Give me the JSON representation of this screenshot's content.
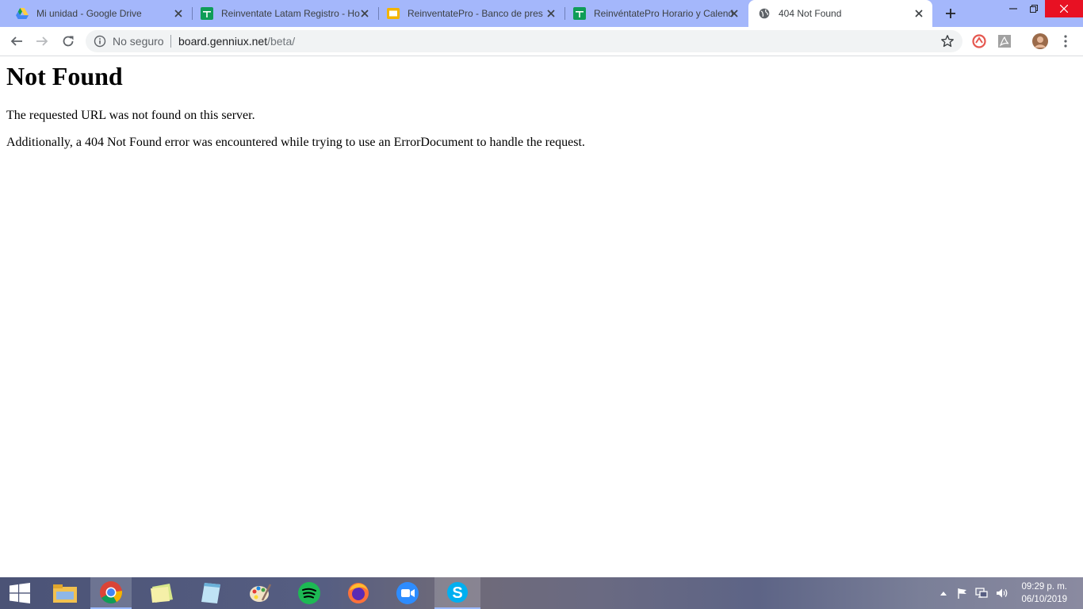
{
  "browser": {
    "tabs": [
      {
        "title": "Mi unidad - Google Drive",
        "icon": "google-drive-icon"
      },
      {
        "title": "Reinventate Latam Registro - Ho",
        "icon": "google-sheets-icon"
      },
      {
        "title": "ReinventatePro - Banco de pres",
        "icon": "google-slides-icon"
      },
      {
        "title": "ReinvéntatePro Horario y Calend",
        "icon": "google-sheets-icon"
      },
      {
        "title": "404 Not Found",
        "icon": "globe-icon",
        "active": true
      }
    ],
    "address_bar": {
      "security_label": "No seguro",
      "url_host": "board.genniux.net",
      "url_path": "/beta/"
    }
  },
  "page": {
    "heading": "Not Found",
    "paragraph1": "The requested URL was not found on this server.",
    "paragraph2": "Additionally, a 404 Not Found error was encountered while trying to use an ErrorDocument to handle the request."
  },
  "taskbar": {
    "apps": [
      "windows-start",
      "file-explorer",
      "chrome",
      "sticky-notes",
      "notepad",
      "paint",
      "spotify",
      "firefox",
      "zoom",
      "skype"
    ],
    "clock_time": "09:29 p. m.",
    "clock_date": "06/10/2019"
  },
  "colors": {
    "tabstrip_bg": "#a4b7fb",
    "omnibox_bg": "#f1f3f4"
  }
}
